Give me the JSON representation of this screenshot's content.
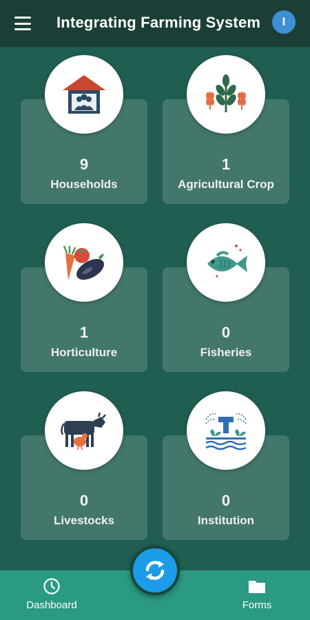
{
  "header": {
    "title": "Integrating Farming System",
    "avatar_initial": "I"
  },
  "cards": [
    {
      "count": "9",
      "label": "Households",
      "icon": "household-icon"
    },
    {
      "count": "1",
      "label": "Agricultural Crop",
      "icon": "crop-icon"
    },
    {
      "count": "1",
      "label": "Horticulture",
      "icon": "vegetables-icon"
    },
    {
      "count": "0",
      "label": "Fisheries",
      "icon": "fish-icon"
    },
    {
      "count": "0",
      "label": "Livestocks",
      "icon": "livestock-icon"
    },
    {
      "count": "0",
      "label": "Institution",
      "icon": "institution-icon"
    }
  ],
  "nav": {
    "dashboard_label": "Dashboard",
    "forms_label": "Forms"
  },
  "colors": {
    "background": "#1f5e50",
    "appbar": "#1b3f36",
    "bottombar": "#2a9a82",
    "fab": "#1c9be8",
    "avatar": "#3e8fd4"
  }
}
